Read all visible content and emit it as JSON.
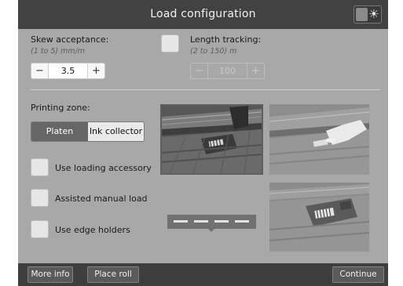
{
  "title": "Load configuration",
  "brightness_icon": "sun-icon",
  "skew": {
    "label": "Skew acceptance:",
    "range": "(1 to 5) mm/m",
    "minus": "−",
    "value": "3.5",
    "plus": "+"
  },
  "length_tracking": {
    "label": "Length tracking:",
    "range": "(2 to 150) m",
    "minus": "−",
    "value": "100",
    "plus": "+"
  },
  "printing_zone": {
    "label": "Printing zone:",
    "options": [
      "Platen",
      "Ink collector"
    ],
    "selected": "Platen"
  },
  "options": {
    "loading_accessory": "Use loading accessory",
    "assisted_manual_load": "Assisted manual load",
    "edge_holders": "Use edge holders"
  },
  "bottom": {
    "more_info": "More info",
    "place_roll": "Place roll",
    "continue": "Continue"
  }
}
